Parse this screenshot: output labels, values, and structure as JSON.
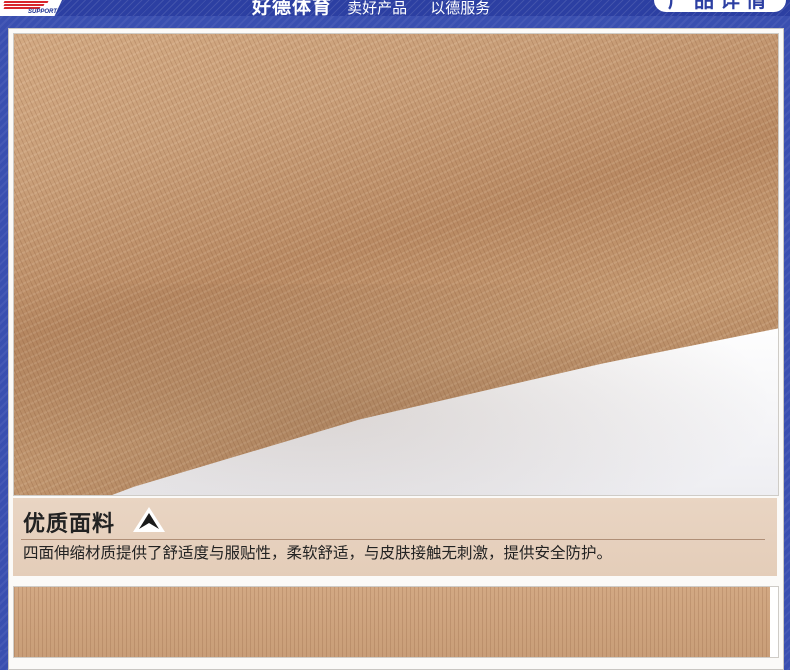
{
  "banner": {
    "logo_word": "SUPPORT",
    "slogan_main": "好德体育",
    "slogan_sub1": "卖好产品",
    "slogan_sub2": "以德服务",
    "badge": "产品详情"
  },
  "section": {
    "title": "优质面料",
    "description": "四面伸缩材质提供了舒适度与服贴性，柔软舒适，与皮肤接触无刺激，提供安全防护。"
  },
  "colors": {
    "banner_blue": "#2c3fa2",
    "logo_red": "#d8262c",
    "caption_bg": "#e9d5c3",
    "fabric_tan": "#c9a07a"
  },
  "icons": {
    "section_arrow": "up-arrow-triangle-icon"
  }
}
